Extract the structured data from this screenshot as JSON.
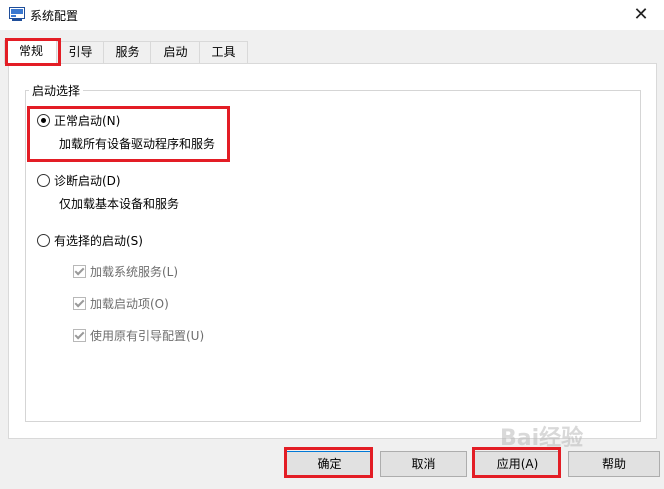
{
  "window": {
    "title": "系统配置",
    "close_glyph": "✕"
  },
  "tabs": [
    {
      "label": "常规"
    },
    {
      "label": "引导"
    },
    {
      "label": "服务"
    },
    {
      "label": "启动"
    },
    {
      "label": "工具"
    }
  ],
  "startup_group": {
    "legend": "启动选择",
    "normal": {
      "label": "正常启动(N)",
      "desc": "加载所有设备驱动程序和服务",
      "checked": true
    },
    "diagnostic": {
      "label": "诊断启动(D)",
      "desc": "仅加载基本设备和服务",
      "checked": false
    },
    "selective": {
      "label": "有选择的启动(S)",
      "checked": false,
      "options": [
        {
          "label": "加载系统服务(L)"
        },
        {
          "label": "加载启动项(O)"
        },
        {
          "label": "使用原有引导配置(U)"
        }
      ]
    }
  },
  "buttons": {
    "ok": "确定",
    "cancel": "取消",
    "apply": "应用(A)",
    "help": "帮助"
  },
  "watermark": "Bai经验",
  "colors": {
    "highlight": "#e31d25",
    "accent": "#0078d7"
  }
}
